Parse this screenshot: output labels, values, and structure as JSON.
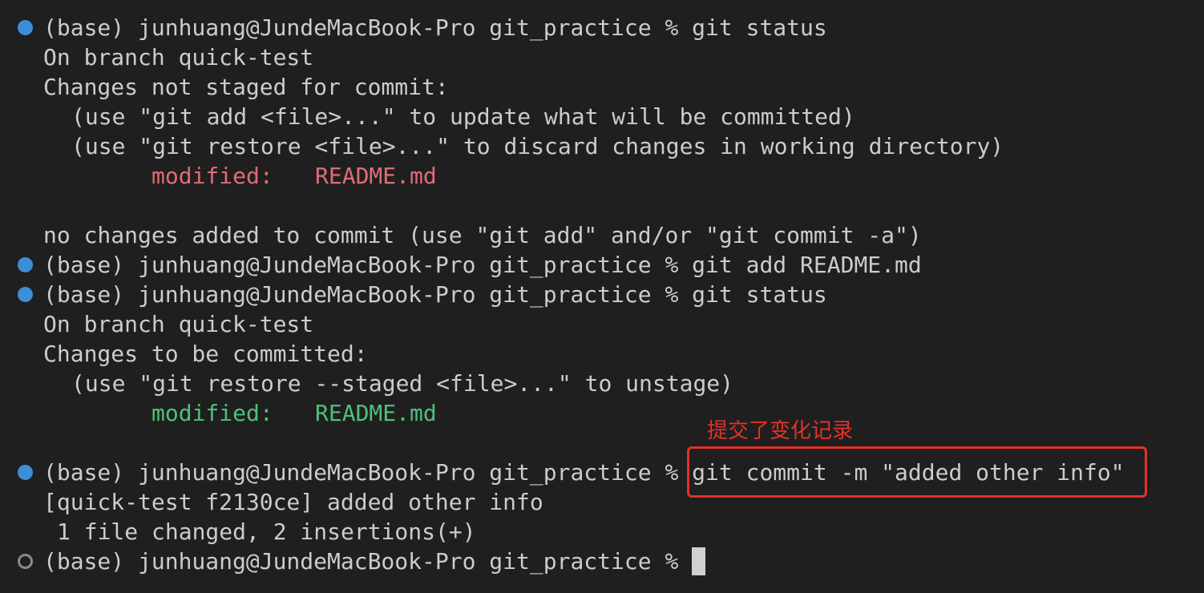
{
  "prompt": "(base) junhuang@JundeMacBook-Pro git_practice % ",
  "lines": {
    "l1_cmd": "git status",
    "l2": "On branch quick-test",
    "l3": "Changes not staged for commit:",
    "l4": "(use \"git add <file>...\" to update what will be committed)",
    "l5": "(use \"git restore <file>...\" to discard changes in working directory)",
    "l6_label": "modified:",
    "l6_file": "README.md",
    "l8": "no changes added to commit (use \"git add\" and/or \"git commit -a\")",
    "l9_cmd": "git add README.md",
    "l10_cmd": "git status",
    "l11": "On branch quick-test",
    "l12": "Changes to be committed:",
    "l13": "(use \"git restore --staged <file>...\" to unstage)",
    "l14_label": "modified:",
    "l14_file": "README.md",
    "l16_cmd": "git commit -m \"added other info\"",
    "l17": "[quick-test f2130ce] added other info",
    "l18": "1 file changed, 2 insertions(+)"
  },
  "annotation": "提交了变化记录",
  "colors": {
    "background": "#1f1f1f",
    "text": "#cccccc",
    "modified_unstaged": "#e06c75",
    "modified_staged": "#4ec07a",
    "gutter_success": "#3c8fd6",
    "annotation": "#e3322b"
  }
}
